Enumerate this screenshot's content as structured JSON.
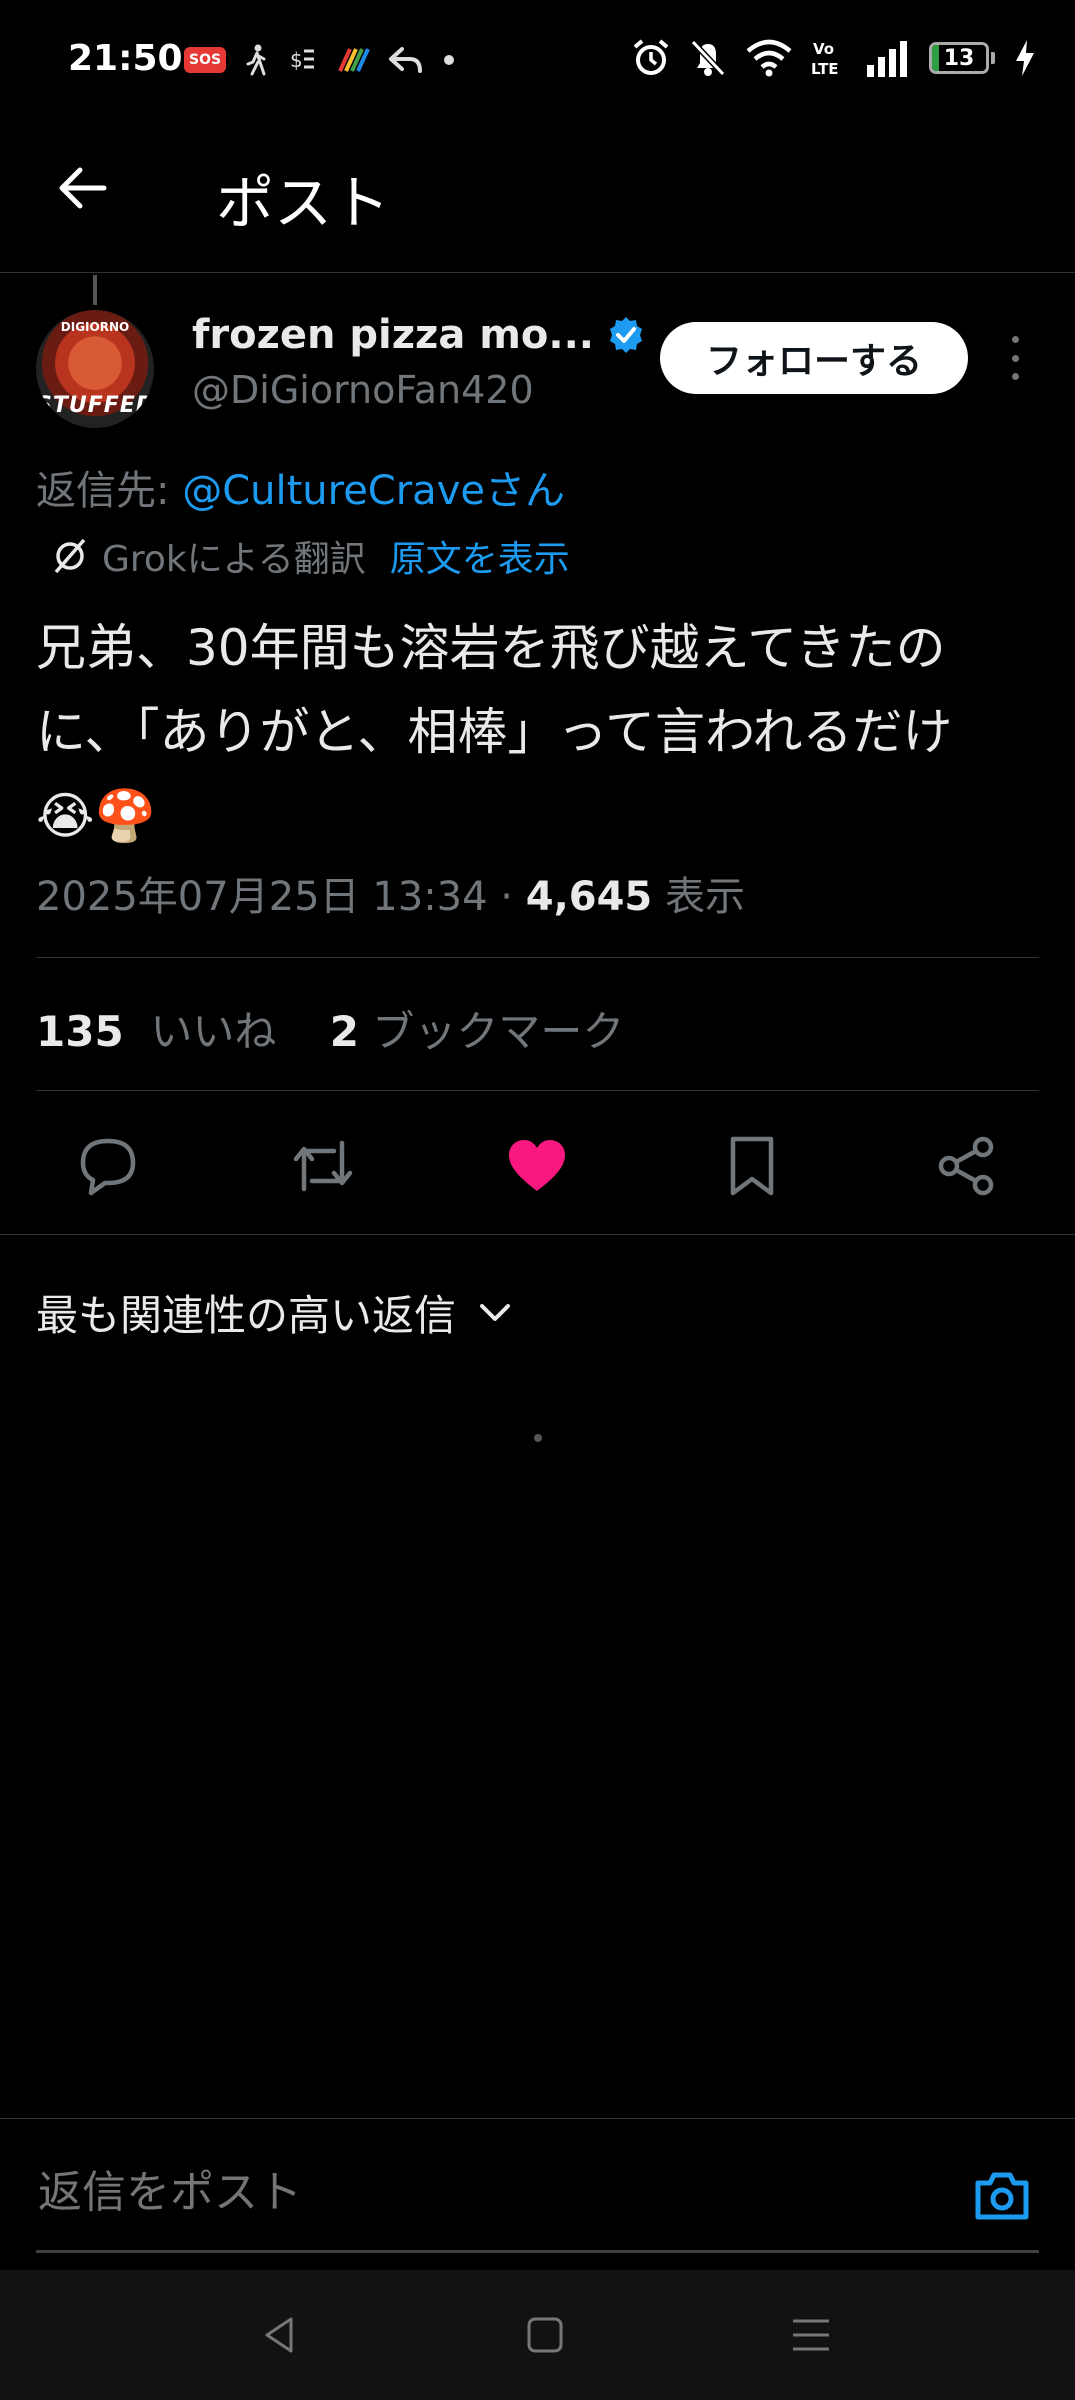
{
  "status_bar": {
    "time": "21:50",
    "sos": "SOS",
    "battery_level": "13",
    "battery_fraction": 0.13,
    "icons": [
      "sos-icon",
      "walking-icon",
      "sync-icon",
      "stripe-icon",
      "reply-icon",
      "dot-icon",
      "alarm-icon",
      "bell-off-icon",
      "wifi-icon",
      "volte-icon",
      "signal-icon",
      "battery-icon",
      "charging-icon"
    ]
  },
  "header": {
    "title": "ポスト"
  },
  "tweet": {
    "display_name": "frozen pizza mo...",
    "handle": "@DiGiornoFan420",
    "avatar_brand": "DIGIORNO",
    "avatar_text": "STUFFED",
    "follow_label": "フォローする",
    "reply_prefix": "返信先: ",
    "reply_mention": "@CultureCraveさん",
    "translation_label": "Grokによる翻訳",
    "show_original": "原文を表示",
    "text_line1": "兄弟、30年間も溶岩を飛び越えてきたの",
    "text_line2": "に、「ありがと、相棒」って言われるだけ",
    "text_emoji": "😭🍄",
    "date": "2025年07月25日 13:34 · ",
    "views_count": "4,645",
    "views_label": " 表示"
  },
  "stats": {
    "likes_count": "135",
    "likes_label": "いいね",
    "bookmarks_count": "2",
    "bookmarks_label": "ブックマーク"
  },
  "actions": {
    "liked_color": "#f91880",
    "icon_color": "#71767b"
  },
  "replies": {
    "sort_label": "最も関連性の高い返信"
  },
  "compose": {
    "placeholder": "返信をポスト",
    "accent": "#1d9bf0"
  }
}
